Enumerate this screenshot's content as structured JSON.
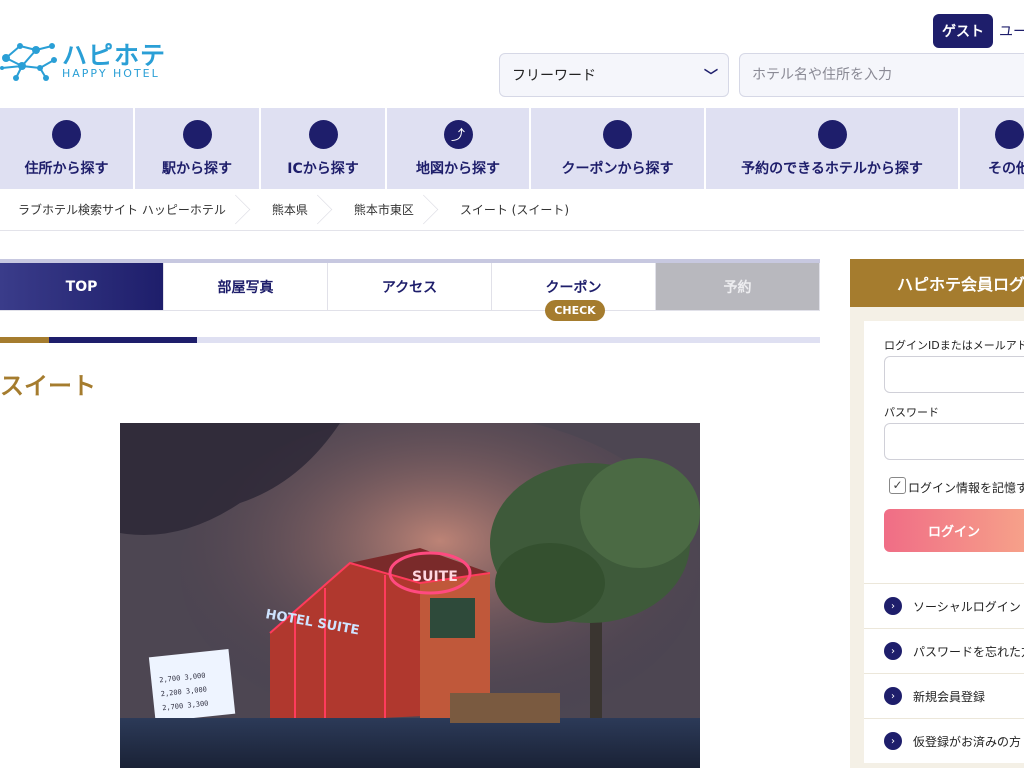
{
  "header": {
    "logo_ja": "ハピホテ",
    "logo_en": "HAPPY HOTEL",
    "guest_label": "ゲスト",
    "user_text": "ユー",
    "keyword_select": "フリーワード",
    "search_placeholder": "ホテル名や住所を入力"
  },
  "category_nav": [
    {
      "label": "住所から探す",
      "icon": "circle-icon"
    },
    {
      "label": "駅から探す",
      "icon": "circle-icon"
    },
    {
      "label": "ICから探す",
      "icon": "circle-icon"
    },
    {
      "label": "地図から探す",
      "icon": "map-icon"
    },
    {
      "label": "クーポンから探す",
      "icon": "circle-icon"
    },
    {
      "label": "予約のできるホテルから探す",
      "icon": "circle-icon"
    },
    {
      "label": "その他",
      "icon": "circle-icon"
    }
  ],
  "breadcrumb": [
    "ラブホテル検索サイト ハッピーホテル",
    "熊本県",
    "熊本市東区",
    "スイート (スイート)"
  ],
  "hotel_tabs": {
    "top": "TOP",
    "photos": "部屋写真",
    "access": "アクセス",
    "coupon": "クーポン",
    "coupon_badge": "CHECK",
    "reserve": "予約"
  },
  "progress": {
    "gold_fraction": 0.06,
    "navy_fraction": 0.18
  },
  "hotel": {
    "name": "スイート",
    "photo_sign_main": "HOTEL SUITE",
    "photo_sign_top": "SUITE",
    "price_rows": [
      "2,700   3,000",
      "2,200   3,000",
      "2,700   3,300"
    ]
  },
  "login": {
    "title": "ハピホテ会員ログ",
    "id_label": "ログインIDまたはメールアドレ",
    "password_label": "パスワード",
    "remember_label": "ログイン情報を記憶す",
    "remember_mark": "✓",
    "login_button": "ログイン",
    "links": [
      "ソーシャルログイン",
      "パスワードを忘れた方",
      "新規会員登録",
      "仮登録がお済みの方"
    ]
  },
  "colors": {
    "navy": "#1e1e6b",
    "gold": "#a57c2e",
    "nav_bg": "#dfe0f2",
    "logo_blue": "#2a9fd6",
    "login_gradient_start": "#f06d86",
    "login_gradient_end": "#f7a88a"
  }
}
